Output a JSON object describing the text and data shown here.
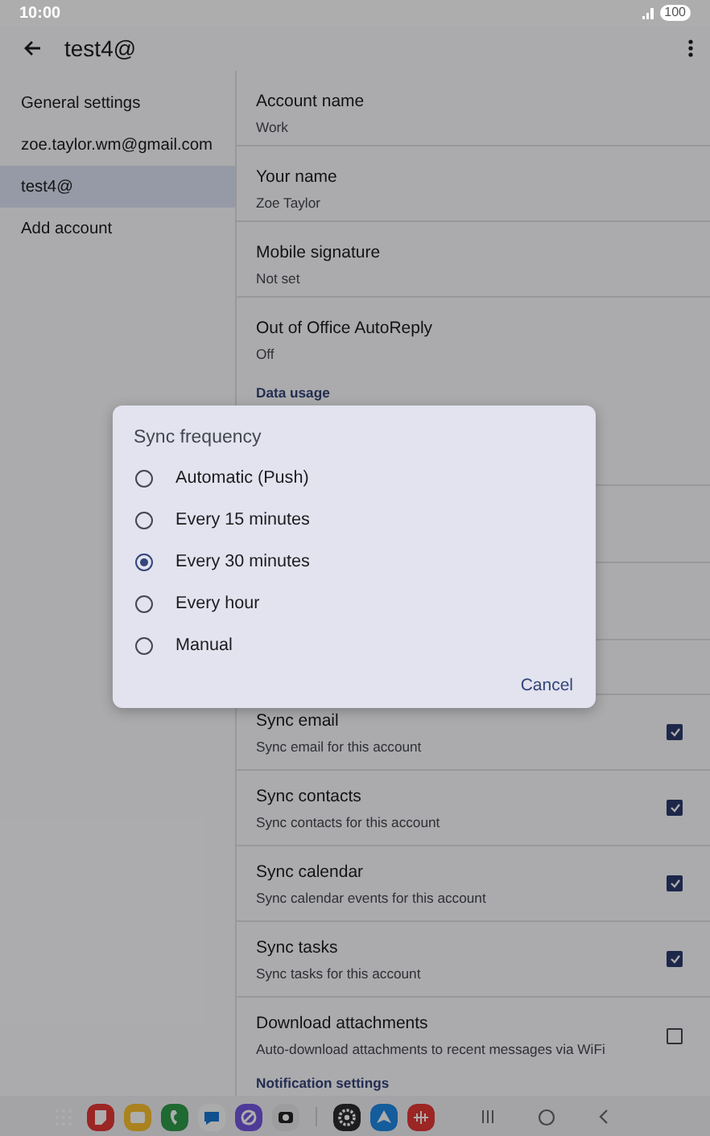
{
  "status_bar": {
    "time": "10:00",
    "battery": "100"
  },
  "app_bar": {
    "title": "test4@"
  },
  "sidebar": {
    "items": [
      {
        "label": "General settings",
        "selected": false
      },
      {
        "label": "zoe.taylor.wm@gmail.com",
        "selected": false
      },
      {
        "label": "test4@",
        "selected": true
      },
      {
        "label": "Add account",
        "selected": false
      }
    ]
  },
  "account_settings": [
    {
      "title": "Account name",
      "summary": "Work"
    },
    {
      "title": "Your name",
      "summary": "Zoe Taylor"
    },
    {
      "title": "Mobile signature",
      "summary": "Not set"
    },
    {
      "title": "Out of Office AutoReply",
      "summary": "Off"
    }
  ],
  "data_usage": {
    "header": "Data usage",
    "items": [
      {
        "title": "Sync email",
        "summary": "Sync email for this account",
        "checked": true
      },
      {
        "title": "Sync contacts",
        "summary": "Sync contacts for this account",
        "checked": true
      },
      {
        "title": "Sync calendar",
        "summary": "Sync calendar events for this account",
        "checked": true
      },
      {
        "title": "Sync tasks",
        "summary": "Sync tasks for this account",
        "checked": true
      },
      {
        "title": "Download attachments",
        "summary": "Auto-download attachments to recent messages via WiFi",
        "checked": false
      }
    ]
  },
  "notification_settings": {
    "header": "Notification settings"
  },
  "dialog": {
    "title": "Sync frequency",
    "options": [
      {
        "label": "Automatic (Push)",
        "selected": false
      },
      {
        "label": "Every 15 minutes",
        "selected": false
      },
      {
        "label": "Every 30 minutes",
        "selected": true
      },
      {
        "label": "Every hour",
        "selected": false
      },
      {
        "label": "Manual",
        "selected": false
      }
    ],
    "buttons": [
      "Cancel"
    ]
  }
}
